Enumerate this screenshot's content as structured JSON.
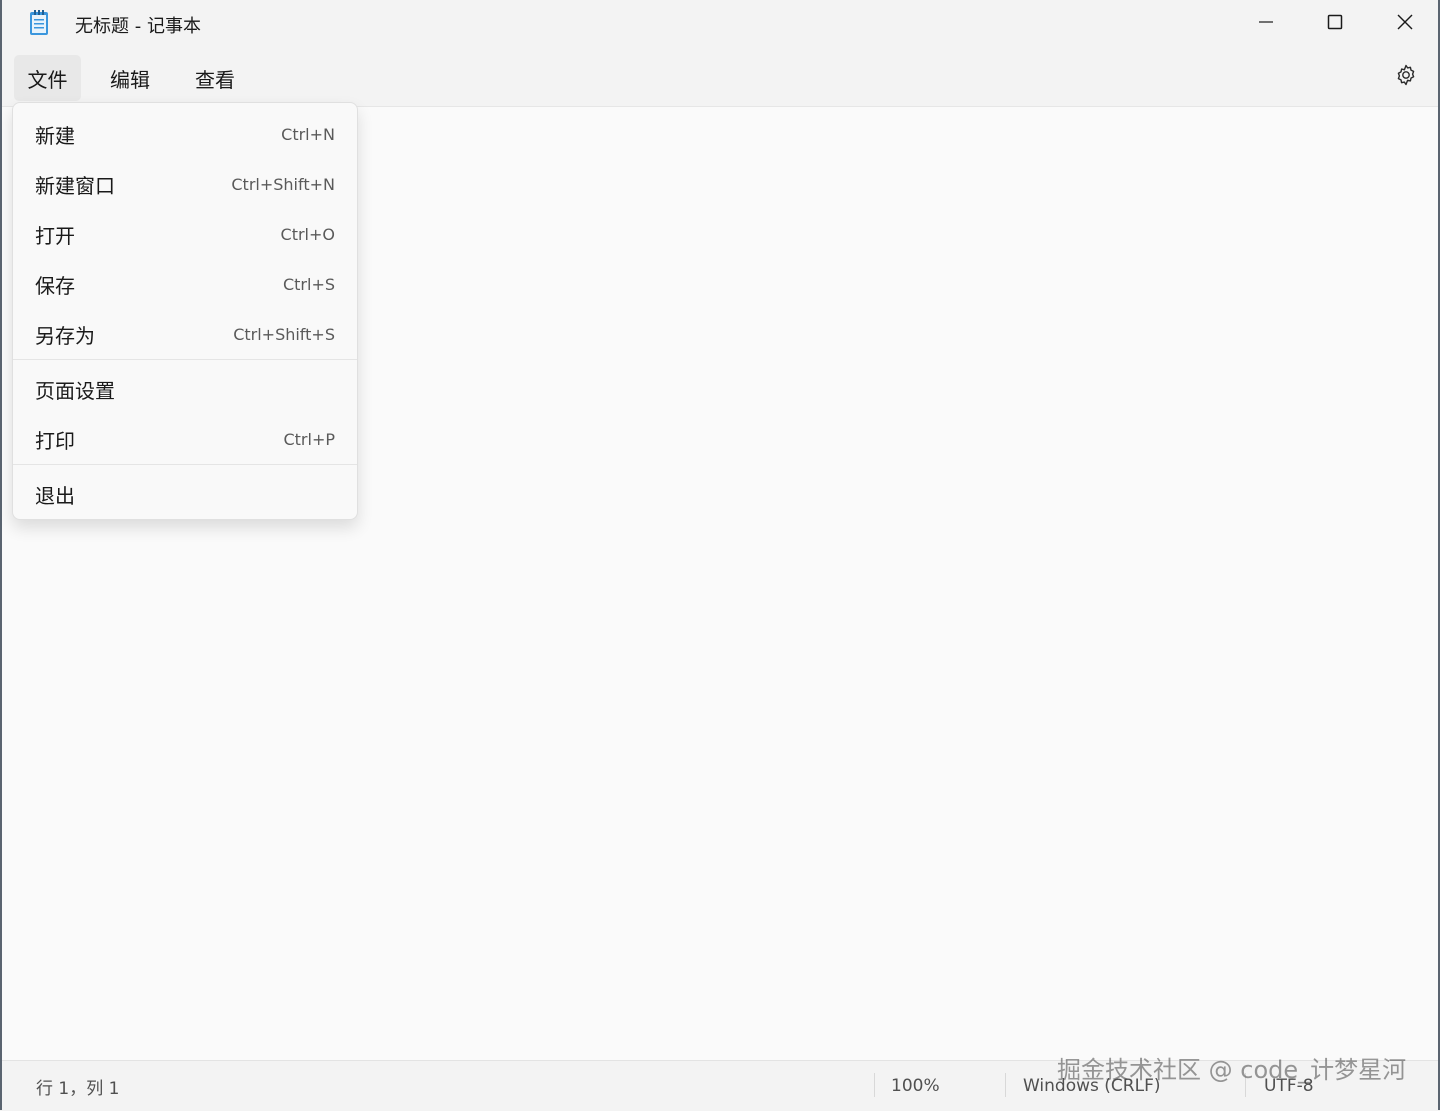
{
  "window": {
    "title": "无标题 - 记事本",
    "app_icon": "notepad-icon",
    "controls": {
      "minimize": "minimize-icon",
      "maximize": "maximize-icon",
      "close": "close-icon"
    }
  },
  "menubar": {
    "items": [
      {
        "label": "文件",
        "active": true
      },
      {
        "label": "编辑"
      },
      {
        "label": "查看"
      }
    ],
    "settings_icon": "gear-icon"
  },
  "file_menu": {
    "items": [
      {
        "label": "新建",
        "shortcut": "Ctrl+N"
      },
      {
        "label": "新建窗口",
        "shortcut": "Ctrl+Shift+N"
      },
      {
        "label": "打开",
        "shortcut": "Ctrl+O"
      },
      {
        "label": "保存",
        "shortcut": "Ctrl+S"
      },
      {
        "label": "另存为",
        "shortcut": "Ctrl+Shift+S"
      },
      {
        "label": "页面设置",
        "shortcut": ""
      },
      {
        "label": "打印",
        "shortcut": "Ctrl+P"
      },
      {
        "label": "退出",
        "shortcut": ""
      }
    ]
  },
  "statusbar": {
    "position": "行 1，列 1",
    "zoom": "100%",
    "line_ending": "Windows (CRLF)",
    "encoding": "UTF-8"
  },
  "watermark": "掘金技术社区 @ code_计梦星河",
  "colors": {
    "menu_background": "#f9f9f9",
    "editor_background": "#fafafa",
    "chrome_background": "#f3f3f3",
    "icon_accent": "#3a96dd"
  }
}
